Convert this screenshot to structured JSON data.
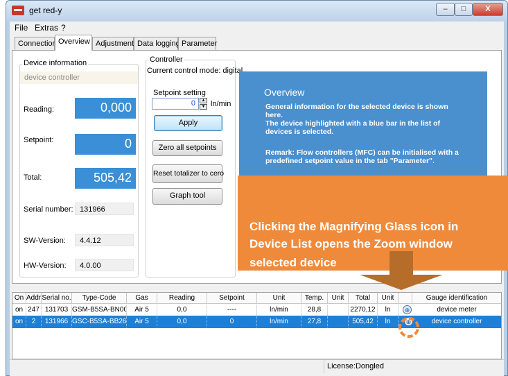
{
  "window": {
    "title": "get red-y",
    "minimize": "–",
    "maximize": "□",
    "close": "X"
  },
  "menu": [
    "File",
    "Extras",
    "?"
  ],
  "tabs": [
    "Connection",
    "Overview",
    "Adjustment",
    "Data logging",
    "Parameter"
  ],
  "device_info": {
    "title": "Device information",
    "device_name": "device controller",
    "reading_label": "Reading:",
    "reading_value": "0,000",
    "setpoint_label": "Setpoint:",
    "setpoint_value": "0",
    "total_label": "Total:",
    "total_value": "505,42",
    "serial_label": "Serial number:",
    "serial_value": "131966",
    "sw_label": "SW-Version:",
    "sw_value": "4.4.12",
    "hw_label": "HW-Version:",
    "hw_value": "4.0.00"
  },
  "controller": {
    "title": "Controller",
    "mode": "Current control mode: digital",
    "setpoint_setting_label": "Setpoint setting",
    "setpoint_setting_value": "0",
    "unit": "ln/min",
    "apply": "Apply",
    "zero_all": "Zero all setpoints",
    "reset_totalizer": "Reset totalizer to cero",
    "graph_tool": "Graph tool"
  },
  "overview": {
    "title": "Overview",
    "lines": [
      "General information for the selected device is shown",
      "here.",
      "The device highlighted with a blue bar in the list of",
      "devices is selected.",
      "",
      "Remark: Flow controllers (MFC) can be initialised with a",
      "predefined setpoint value in the tab \"Parameter\"."
    ]
  },
  "tooltip": {
    "lines": [
      "Clicking the Magnifying Glass icon in",
      "Device List opens the Zoom window",
      "selected device"
    ]
  },
  "table": {
    "headers": [
      "On",
      "Addr.",
      "Serial no.",
      "Type-Code",
      "Gas",
      "Reading",
      "Setpoint",
      "Unit",
      "Temp.",
      "Unit",
      "Total",
      "Unit",
      "",
      "Gauge identification"
    ],
    "rows": [
      [
        "on",
        "247",
        "131703",
        "GSM-B5SA-BN00",
        "Air 5",
        "0,0",
        "----",
        "ln/min",
        "28,8",
        "",
        "2270,12",
        "ln",
        "",
        "device meter"
      ],
      [
        "on",
        "2",
        "131966",
        "GSC-B5SA-BB26",
        "Air 5",
        "0,0",
        "0",
        "ln/min",
        "27,8",
        "",
        "505,42",
        "ln",
        "",
        "device controller"
      ]
    ],
    "selected_row": 1
  },
  "status": {
    "license": "License:Dongled"
  },
  "colors": {
    "selection": "#1e7fd6",
    "value_box": "#3a8fd6",
    "tooltip": "#f08a3b"
  },
  "icons": {
    "zoom": "magnifying-glass-icon",
    "spin_up": "▲",
    "spin_down": "▼"
  }
}
